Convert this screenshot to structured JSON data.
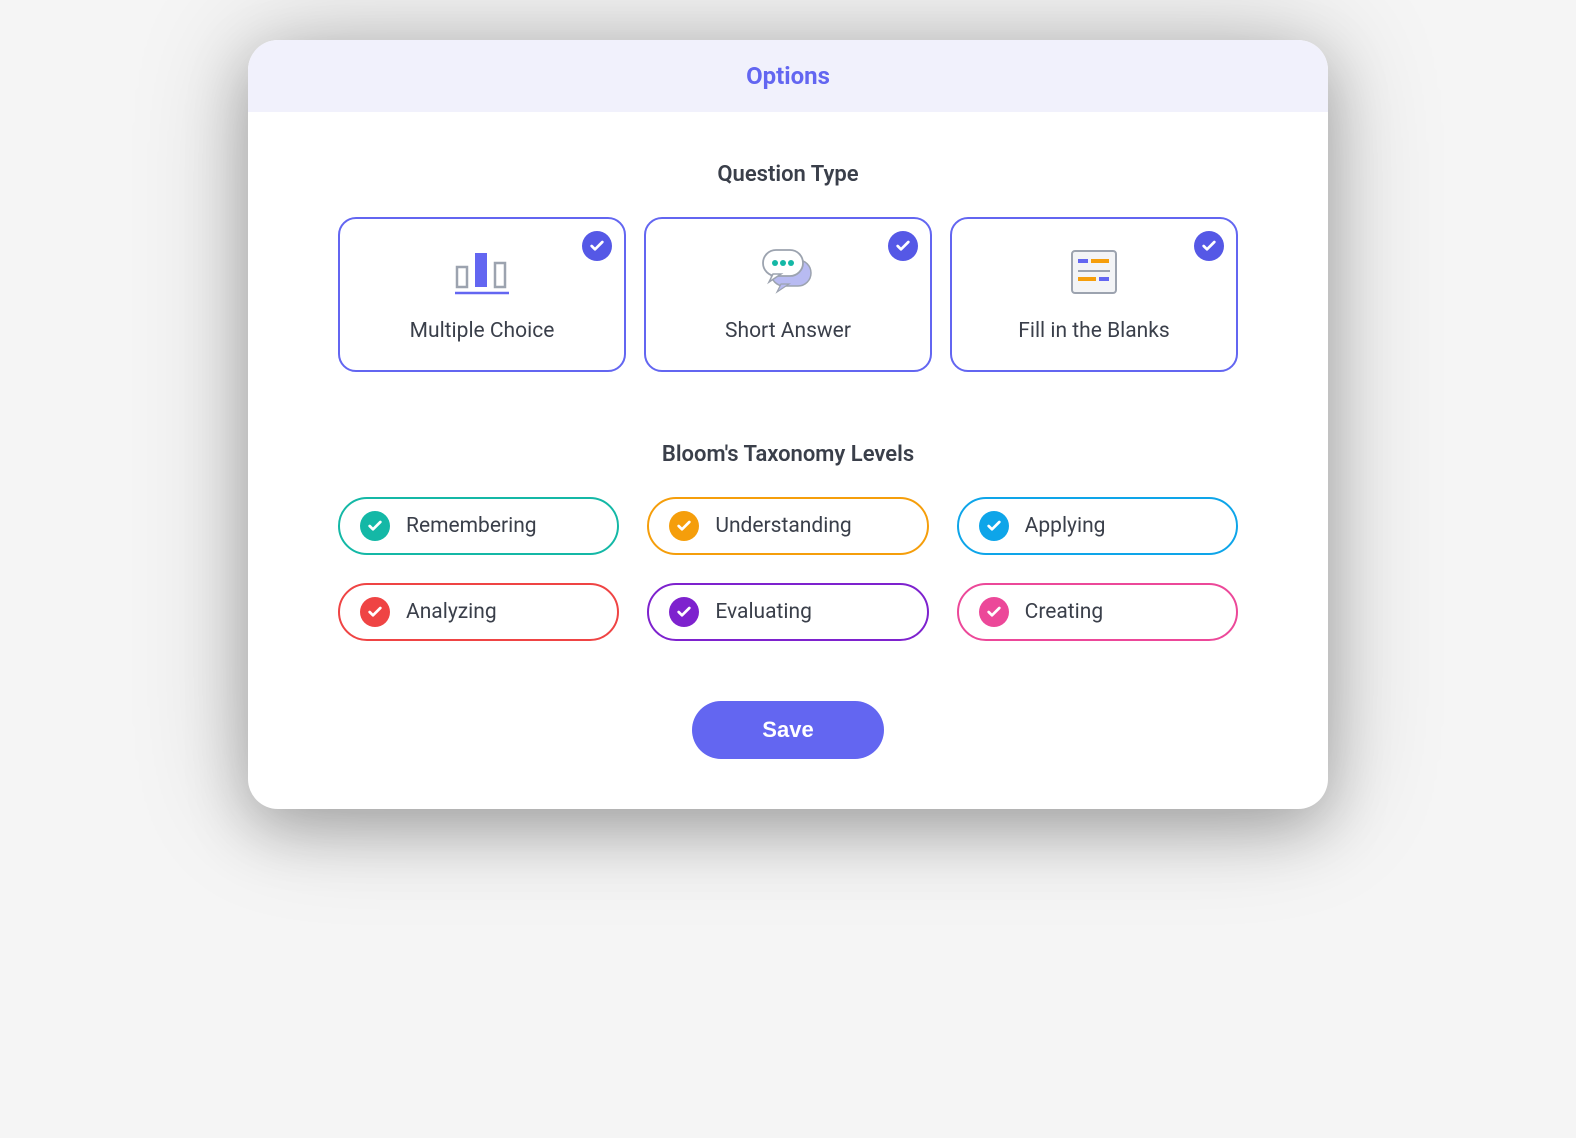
{
  "header": {
    "title": "Options"
  },
  "questionType": {
    "title": "Question Type",
    "items": [
      {
        "label": "Multiple Choice",
        "selected": true
      },
      {
        "label": "Short Answer",
        "selected": true
      },
      {
        "label": "Fill in the Blanks",
        "selected": true
      }
    ]
  },
  "taxonomy": {
    "title": "Bloom's Taxonomy Levels",
    "items": [
      {
        "label": "Remembering",
        "color": "#14b8a6",
        "selected": true
      },
      {
        "label": "Understanding",
        "color": "#f59e0b",
        "selected": true
      },
      {
        "label": "Applying",
        "color": "#0ea5e9",
        "selected": true
      },
      {
        "label": "Analyzing",
        "color": "#ef4444",
        "selected": true
      },
      {
        "label": "Evaluating",
        "color": "#7e22ce",
        "selected": true
      },
      {
        "label": "Creating",
        "color": "#ec4899",
        "selected": true
      }
    ]
  },
  "actions": {
    "save_label": "Save"
  },
  "colors": {
    "accent": "#6366f1",
    "headerBg": "#f1f1fc"
  }
}
